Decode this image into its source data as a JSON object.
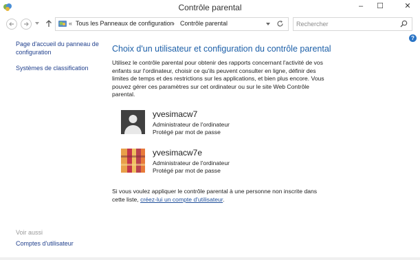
{
  "window": {
    "title": "Contrôle parental",
    "minimize": "–",
    "maximize": "☐",
    "close": "✕"
  },
  "navigation": {
    "breadcrumb_prefix": "«",
    "breadcrumb": [
      "Tous les Panneaux de configuration",
      "Contrôle parental"
    ],
    "search_placeholder": "Rechercher"
  },
  "sidebar": {
    "home_link": "Page d'accueil du panneau de configuration",
    "ratings_link": "Systèmes de classification",
    "see_also": "Voir aussi",
    "user_accounts_link": "Comptes d'utilisateur"
  },
  "main": {
    "heading": "Choix d'un utilisateur et configuration du contrôle parental",
    "intro": "Utilisez le contrôle parental pour obtenir des rapports concernant l'activité de vos enfants sur l'ordinateur, choisir ce qu'ils peuvent consulter en ligne, définir des limites de temps et des restrictions sur les applications, et bien plus encore. Vous pouvez gérer ces paramètres sur cet ordinateur ou sur le site Web Contrôle parental.",
    "users": [
      {
        "name": "yvesimacw7",
        "role": "Administrateur de l'ordinateur",
        "protection": "Protégé par mot de passe",
        "avatar": "default-user-icon"
      },
      {
        "name": "yvesimacw7e",
        "role": "Administrateur de l'ordinateur",
        "protection": "Protégé par mot de passe",
        "avatar": "colorful-photo"
      }
    ],
    "note_text": "Si vous voulez appliquer le contrôle parental à une personne non inscrite dans cette liste, ",
    "note_link": "créez-lui un compte d'utilisateur",
    "note_end": "."
  },
  "colors": {
    "heading": "#1c5fa8",
    "link": "#1e4e9a",
    "help": "#2a74c5"
  }
}
